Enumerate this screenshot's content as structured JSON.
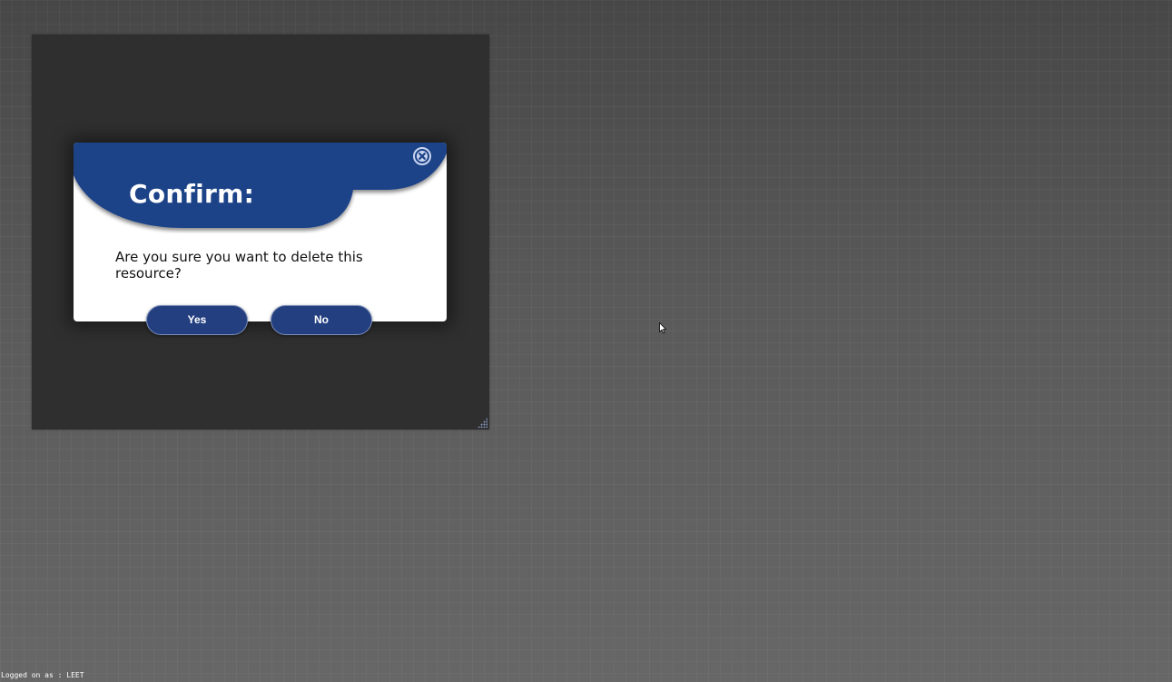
{
  "dialog": {
    "title": "Confirm:",
    "message": "Are you sure you want to delete this resource?",
    "yes_label": "Yes",
    "no_label": "No",
    "close_icon": "close-circle-icon"
  },
  "status_bar": {
    "text": "Logged on as : LEET"
  },
  "colors": {
    "header_blue": "#1d4287",
    "button_blue": "#233f80",
    "panel_background": "#2f2f2f",
    "desktop_background": "#555555"
  }
}
